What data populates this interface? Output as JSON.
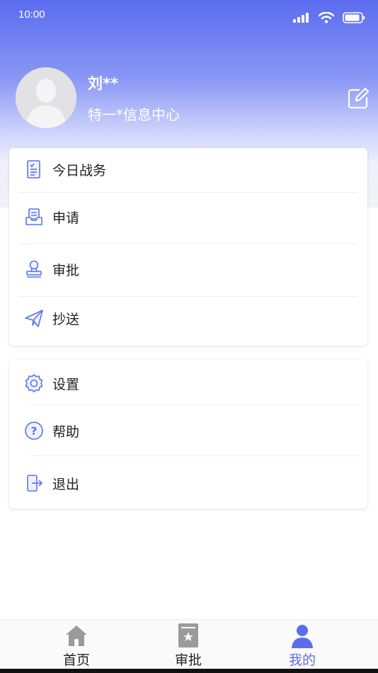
{
  "status_bar": {
    "time": "10:00"
  },
  "profile": {
    "name": "刘**",
    "department": "特一*信息中心"
  },
  "menu_group_1": [
    {
      "label": "今日战务",
      "icon": "clipboard-checklist-icon"
    },
    {
      "label": "申请",
      "icon": "inbox-document-icon"
    },
    {
      "label": "审批",
      "icon": "stamp-icon"
    },
    {
      "label": "抄送",
      "icon": "paper-plane-icon"
    }
  ],
  "menu_group_2": [
    {
      "label": "设置",
      "icon": "gear-icon"
    },
    {
      "label": "帮助",
      "icon": "help-circle-icon"
    },
    {
      "label": "退出",
      "icon": "logout-icon"
    }
  ],
  "tabbar": {
    "tabs": [
      {
        "label": "首页",
        "icon": "home-icon"
      },
      {
        "label": "审批",
        "icon": "approval-doc-icon"
      },
      {
        "label": "我的",
        "icon": "user-icon"
      }
    ],
    "active_index": 2
  },
  "colors": {
    "accent": "#5b6cf0",
    "icon_blue": "#5b73e8",
    "tab_inactive_icon": "#9a9a9a"
  }
}
